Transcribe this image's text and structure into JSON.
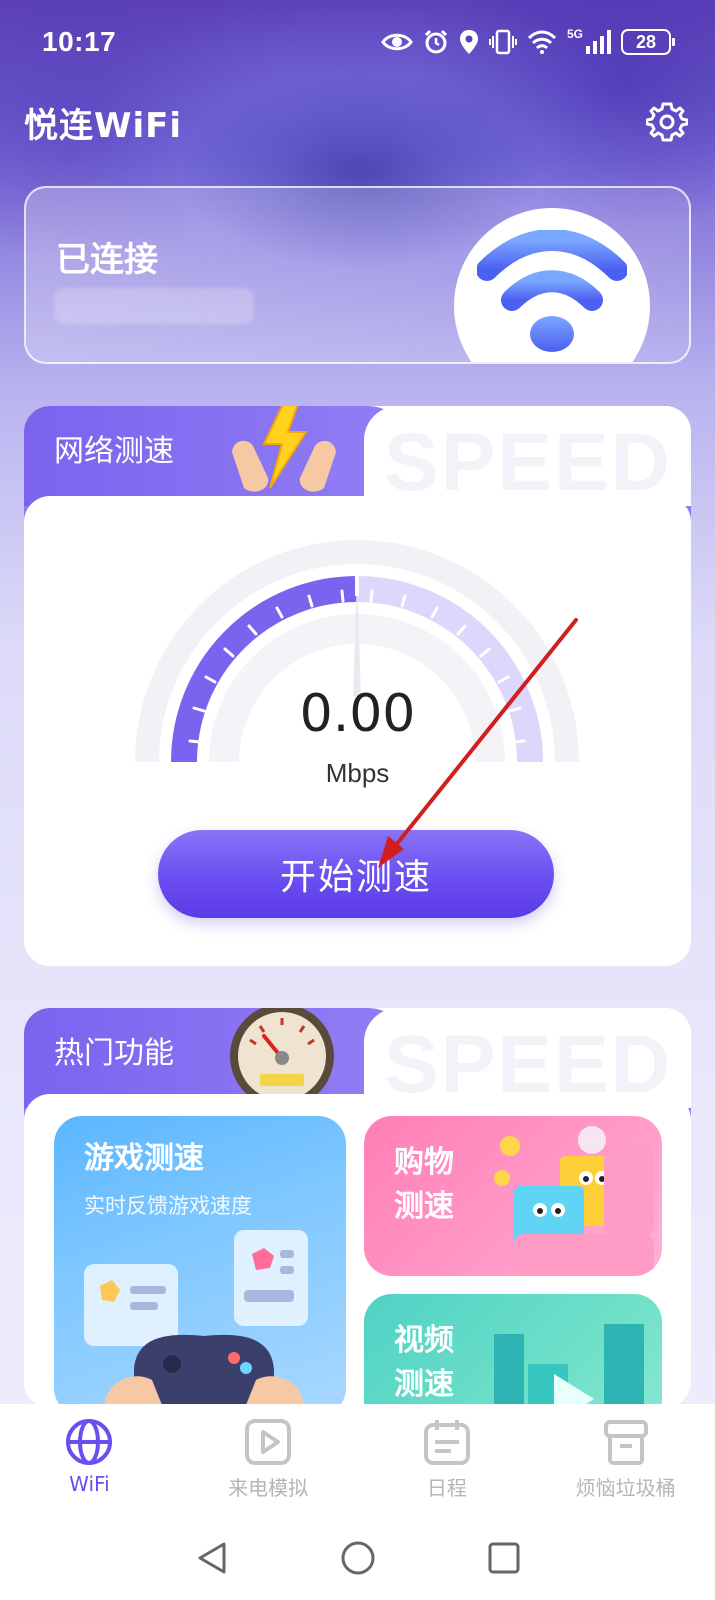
{
  "status_bar": {
    "time": "10:17",
    "network": "5G",
    "battery": "28"
  },
  "header": {
    "title": "悦连WiFi"
  },
  "connection": {
    "status": "已连接"
  },
  "speed_test": {
    "section_title": "网络测速",
    "bg_word": "SPEED",
    "value": "0.00",
    "unit": "Mbps",
    "start_button": "开始测速"
  },
  "hot_features": {
    "section_title": "热门功能",
    "bg_word": "SPEED",
    "tiles": [
      {
        "title": "游戏测速",
        "subtitle": "实时反馈游戏速度"
      },
      {
        "title_line1": "购物",
        "title_line2": "测速"
      },
      {
        "title_line1": "视频",
        "title_line2": "测速"
      }
    ]
  },
  "bottom_nav": {
    "items": [
      {
        "label": "WiFi",
        "icon": "globe-icon",
        "active": true
      },
      {
        "label": "来电模拟",
        "icon": "play-icon",
        "active": false
      },
      {
        "label": "日程",
        "icon": "calendar-icon",
        "active": false
      },
      {
        "label": "烦恼垃圾桶",
        "icon": "trash-bin-icon",
        "active": false
      }
    ]
  },
  "colors": {
    "accent": "#6a4ff0",
    "inactive": "#b5b5bb",
    "annotation_arrow": "#d11f1f"
  }
}
